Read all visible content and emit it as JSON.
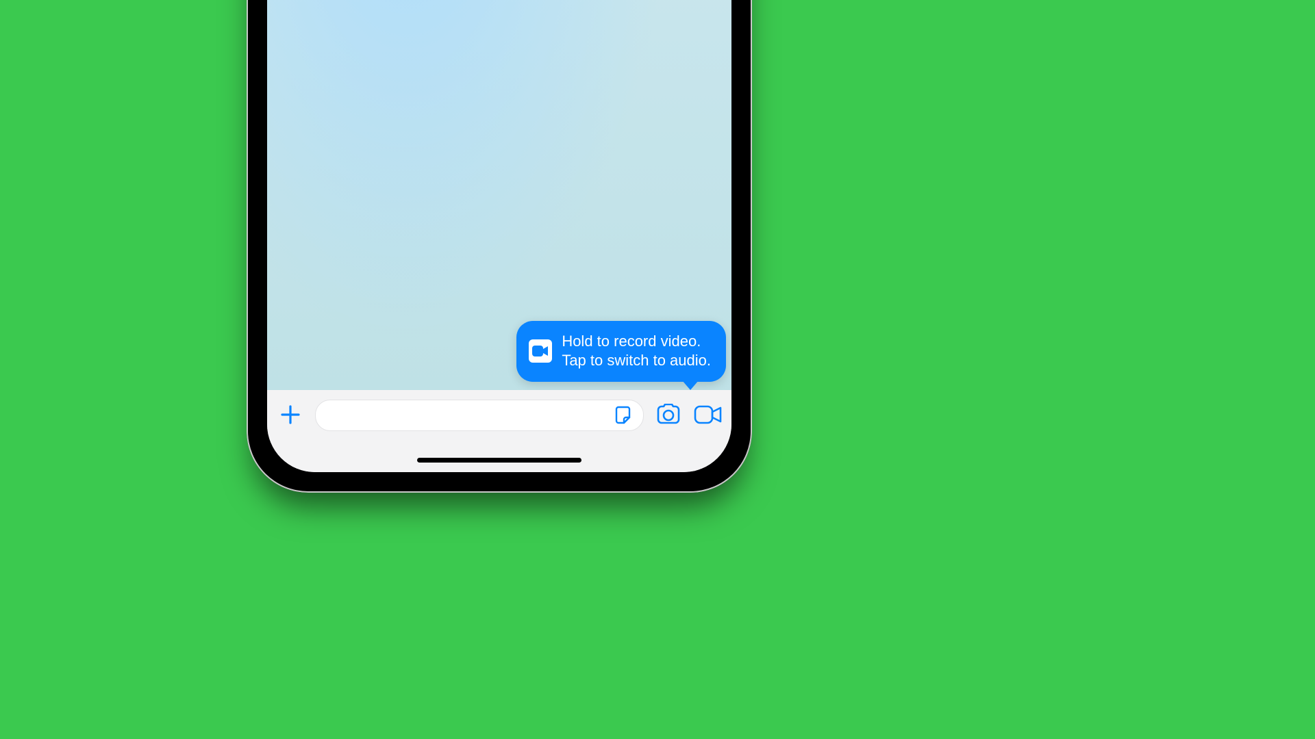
{
  "colors": {
    "background": "#3bc94f",
    "accent": "#0a84ff",
    "bubble_text": "#ffffff",
    "input_bg": "#ffffff",
    "bar_bg": "#f3f3f4"
  },
  "tooltip": {
    "icon": "video-icon",
    "line1": "Hold to record video.",
    "line2": "Tap to switch to audio."
  },
  "inputbar": {
    "plus_icon": "plus-icon",
    "text_placeholder": "",
    "sticker_icon": "sticker-icon",
    "camera_icon": "camera-icon",
    "video_icon": "video-icon"
  }
}
